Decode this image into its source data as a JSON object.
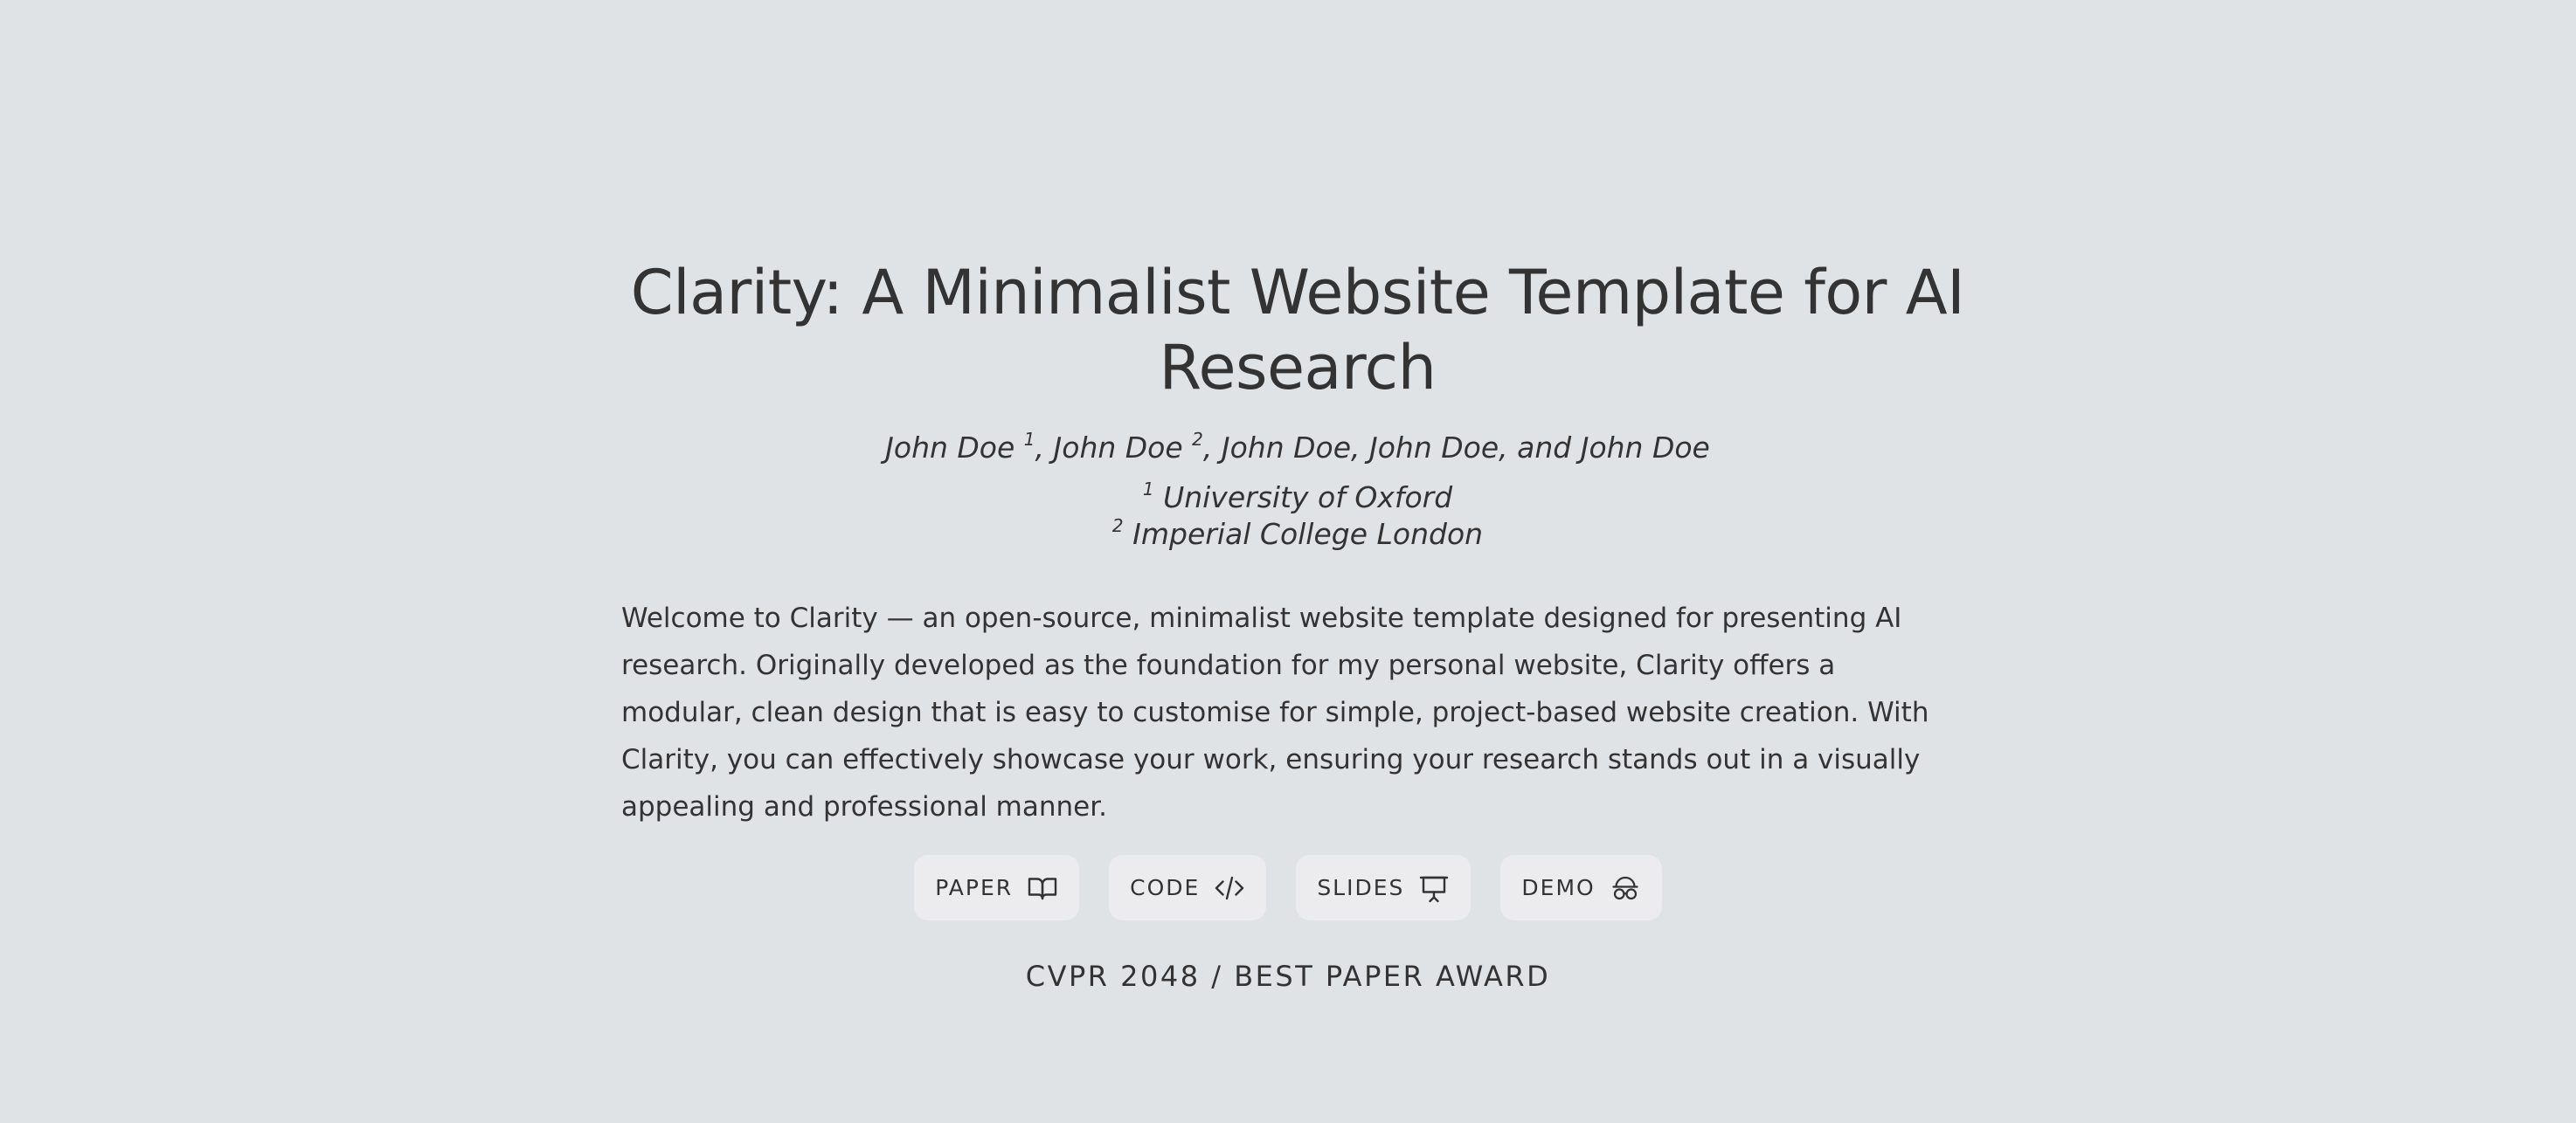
{
  "title": "Clarity: A Minimalist Website Template for AI Research",
  "authors": {
    "a1_name": "John Doe",
    "a1_sup": "1",
    "a2_name": "John Doe",
    "a2_sup": "2",
    "rest": ", John Doe, John Doe, and John Doe"
  },
  "affiliations": [
    {
      "sup": "1",
      "name": "University of Oxford"
    },
    {
      "sup": "2",
      "name": "Imperial College London"
    }
  ],
  "intro": "Welcome to Clarity — an open-source, minimalist website template designed for presenting AI research. Originally developed as the foundation for my personal website, Clarity offers a modular, clean design that is easy to customise for simple, project-based website creation. With Clarity, you can effectively showcase your work, ensuring your research stands out in a visually appealing and professional manner.",
  "buttons": [
    {
      "label": "PAPER",
      "icon": "book-open-icon"
    },
    {
      "label": "CODE",
      "icon": "code-icon"
    },
    {
      "label": "SLIDES",
      "icon": "presentation-icon"
    },
    {
      "label": "DEMO",
      "icon": "incognito-icon"
    }
  ],
  "award": "CVPR 2048 / BEST PAPER AWARD",
  "colors": {
    "background": "#e0e3e6",
    "text": "#333333",
    "button_bg": "#ececee"
  }
}
